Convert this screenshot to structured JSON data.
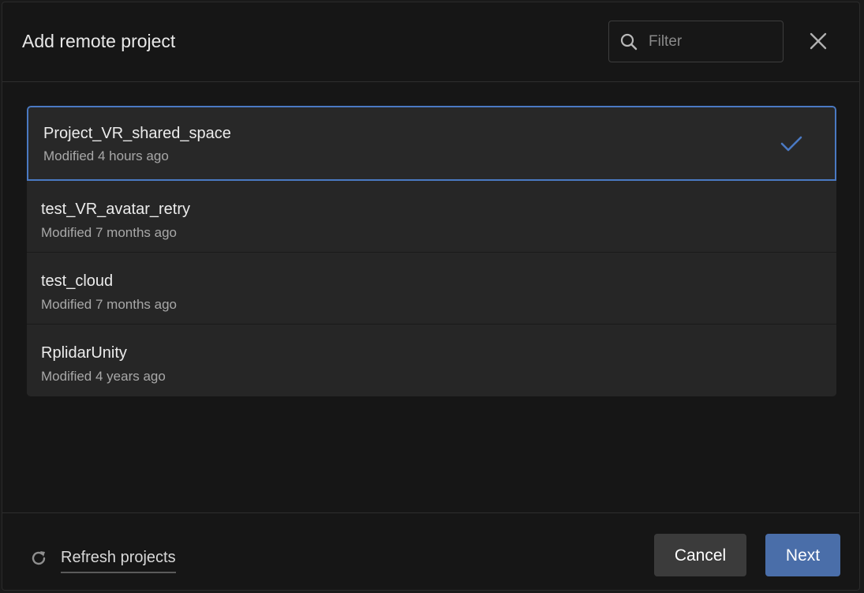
{
  "dialog": {
    "title": "Add remote project",
    "filter_placeholder": "Filter"
  },
  "icons": {
    "search": "search-icon",
    "close": "close-icon",
    "check": "check-icon",
    "refresh": "refresh-icon"
  },
  "projects": [
    {
      "name": "Project_VR_shared_space",
      "modified": "Modified 4 hours ago",
      "selected": true
    },
    {
      "name": "test_VR_avatar_retry",
      "modified": "Modified 7 months ago",
      "selected": false
    },
    {
      "name": "test_cloud",
      "modified": "Modified 7 months ago",
      "selected": false
    },
    {
      "name": "RplidarUnity",
      "modified": "Modified 4 years ago",
      "selected": false
    }
  ],
  "footer": {
    "refresh_label": "Refresh projects",
    "cancel_label": "Cancel",
    "next_label": "Next"
  },
  "colors": {
    "accent": "#4a79c2",
    "next_button": "#4a6ea9",
    "cancel_button": "#3b3b3b",
    "background": "#161616"
  }
}
